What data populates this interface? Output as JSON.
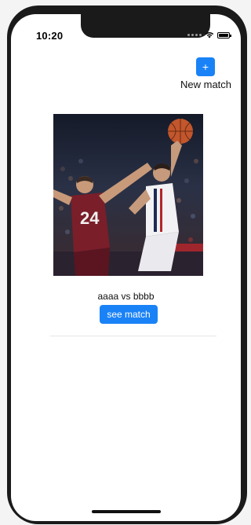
{
  "status_bar": {
    "time": "10:20"
  },
  "header": {
    "add_icon_glyph": "+",
    "new_match_label": "New match"
  },
  "matches": [
    {
      "title": "aaaa vs bbbb",
      "see_button_label": "see match",
      "jersey_number": "24"
    }
  ],
  "colors": {
    "accent": "#1a82f7"
  }
}
